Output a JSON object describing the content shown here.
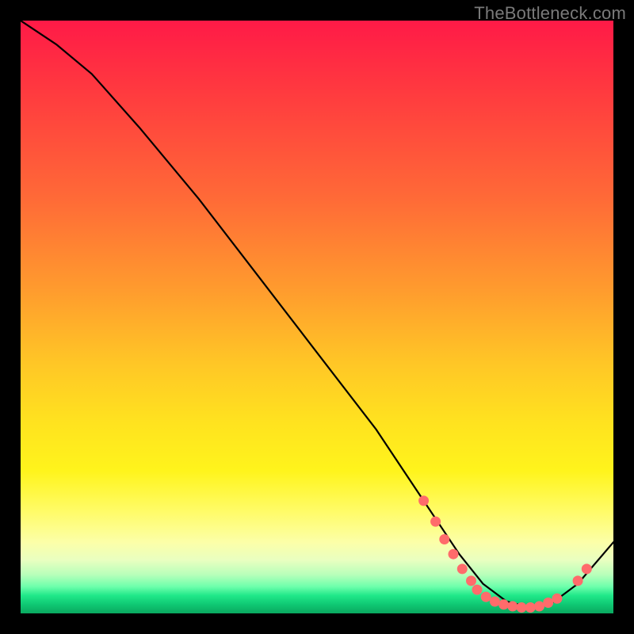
{
  "watermark": "TheBottleneck.com",
  "chart_data": {
    "type": "line",
    "title": "",
    "xlabel": "",
    "ylabel": "",
    "xlim": [
      0,
      100
    ],
    "ylim": [
      0,
      100
    ],
    "grid": false,
    "series": [
      {
        "name": "curve",
        "x": [
          0,
          6,
          12,
          20,
          30,
          40,
          50,
          60,
          68,
          74,
          78,
          82,
          86,
          90,
          94,
          100
        ],
        "y": [
          100,
          96,
          91,
          82,
          70,
          57,
          44,
          31,
          19,
          10,
          5,
          2,
          1,
          2,
          5,
          12
        ]
      }
    ],
    "markers": [
      {
        "x": 68.0,
        "y": 19.0
      },
      {
        "x": 70.0,
        "y": 15.5
      },
      {
        "x": 71.5,
        "y": 12.5
      },
      {
        "x": 73.0,
        "y": 10.0
      },
      {
        "x": 74.5,
        "y": 7.5
      },
      {
        "x": 76.0,
        "y": 5.5
      },
      {
        "x": 77.0,
        "y": 4.0
      },
      {
        "x": 78.5,
        "y": 2.8
      },
      {
        "x": 80.0,
        "y": 2.0
      },
      {
        "x": 81.5,
        "y": 1.5
      },
      {
        "x": 83.0,
        "y": 1.2
      },
      {
        "x": 84.5,
        "y": 1.0
      },
      {
        "x": 86.0,
        "y": 1.0
      },
      {
        "x": 87.5,
        "y": 1.2
      },
      {
        "x": 89.0,
        "y": 1.8
      },
      {
        "x": 90.5,
        "y": 2.5
      },
      {
        "x": 94.0,
        "y": 5.5
      },
      {
        "x": 95.5,
        "y": 7.5
      }
    ],
    "marker_color": "#ff6b6b",
    "curve_color": "#000000"
  }
}
